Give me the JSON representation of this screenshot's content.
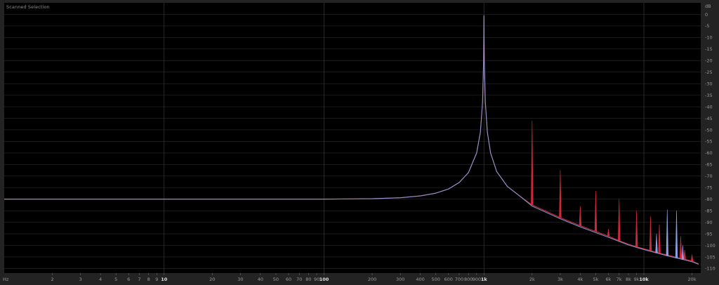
{
  "panel": {
    "title": "Scanned Selection"
  },
  "colors": {
    "background": "#000000",
    "frame": "#232323",
    "grid": "#2a2a2a",
    "channel_left": "#d0283a",
    "channel_right": "#8aa0e0"
  },
  "chart_data": {
    "type": "line",
    "title": "Scanned Selection",
    "x_scale": "log",
    "x_unit_label": "Hz",
    "y_unit_label": "dB",
    "xlim": [
      1,
      22000
    ],
    "ylim": [
      -112,
      5
    ],
    "grid": true,
    "x_ticks": [
      {
        "value": 2,
        "label": "2"
      },
      {
        "value": 3,
        "label": "3"
      },
      {
        "value": 4,
        "label": "4"
      },
      {
        "value": 5,
        "label": "5"
      },
      {
        "value": 6,
        "label": "6"
      },
      {
        "value": 7,
        "label": "7"
      },
      {
        "value": 8,
        "label": "8"
      },
      {
        "value": 9,
        "label": "9"
      },
      {
        "value": 10,
        "label": "10",
        "major": true
      },
      {
        "value": 20,
        "label": "20"
      },
      {
        "value": 30,
        "label": "30"
      },
      {
        "value": 40,
        "label": "40"
      },
      {
        "value": 50,
        "label": "50"
      },
      {
        "value": 60,
        "label": "60"
      },
      {
        "value": 70,
        "label": "70"
      },
      {
        "value": 80,
        "label": "80"
      },
      {
        "value": 90,
        "label": "90"
      },
      {
        "value": 100,
        "label": "100",
        "major": true
      },
      {
        "value": 200,
        "label": "200"
      },
      {
        "value": 300,
        "label": "300"
      },
      {
        "value": 400,
        "label": "400"
      },
      {
        "value": 500,
        "label": "500"
      },
      {
        "value": 600,
        "label": "600"
      },
      {
        "value": 700,
        "label": "700"
      },
      {
        "value": 800,
        "label": "800"
      },
      {
        "value": 900,
        "label": "900"
      },
      {
        "value": 1000,
        "label": "1k",
        "major": true
      },
      {
        "value": 2000,
        "label": "2k"
      },
      {
        "value": 3000,
        "label": "3k"
      },
      {
        "value": 4000,
        "label": "4k"
      },
      {
        "value": 5000,
        "label": "5k"
      },
      {
        "value": 6000,
        "label": "6k"
      },
      {
        "value": 7000,
        "label": "7k"
      },
      {
        "value": 8000,
        "label": "8k"
      },
      {
        "value": 9000,
        "label": "9k"
      },
      {
        "value": 10000,
        "label": "10k",
        "major": true
      },
      {
        "value": 20000,
        "label": "20k"
      }
    ],
    "y_ticks": [
      0,
      -5,
      -10,
      -15,
      -20,
      -25,
      -30,
      -35,
      -40,
      -45,
      -50,
      -55,
      -60,
      -65,
      -70,
      -75,
      -80,
      -85,
      -90,
      -95,
      -100,
      -105,
      -110
    ],
    "series": [
      {
        "channel": "left",
        "points": [
          [
            1,
            -80
          ],
          [
            10,
            -80
          ],
          [
            100,
            -80
          ],
          [
            200,
            -79.8
          ],
          [
            300,
            -79.4
          ],
          [
            400,
            -78.6
          ],
          [
            500,
            -77.4
          ],
          [
            600,
            -75.6
          ],
          [
            700,
            -72.8
          ],
          [
            800,
            -68.5
          ],
          [
            900,
            -60
          ],
          [
            950,
            -51
          ],
          [
            980,
            -38
          ],
          [
            995,
            -20
          ],
          [
            1000,
            -1
          ],
          [
            1005,
            -20
          ],
          [
            1020,
            -38
          ],
          [
            1050,
            -51
          ],
          [
            1100,
            -60
          ],
          [
            1200,
            -68
          ],
          [
            1400,
            -74.5
          ],
          [
            1700,
            -79
          ],
          [
            2000,
            -82.5
          ],
          [
            3000,
            -88
          ],
          [
            4000,
            -91.5
          ],
          [
            5000,
            -94
          ],
          [
            6000,
            -96
          ],
          [
            7000,
            -98
          ],
          [
            8000,
            -99.5
          ],
          [
            9000,
            -100.6
          ],
          [
            10000,
            -101.5
          ],
          [
            12000,
            -103
          ],
          [
            14000,
            -104.2
          ],
          [
            16000,
            -105.2
          ],
          [
            18000,
            -106
          ],
          [
            20000,
            -106.8
          ],
          [
            22000,
            -108
          ]
        ],
        "harmonics": [
          [
            2000,
            -46
          ],
          [
            3000,
            -67.5
          ],
          [
            4000,
            -83
          ],
          [
            5000,
            -76.5
          ],
          [
            6000,
            -93
          ],
          [
            7000,
            -80
          ],
          [
            9000,
            -85
          ],
          [
            11000,
            -87.5
          ],
          [
            12500,
            -91
          ],
          [
            17000,
            -96
          ],
          [
            18000,
            -102
          ],
          [
            20000,
            -104
          ]
        ]
      },
      {
        "channel": "right",
        "points": [
          [
            1,
            -80
          ],
          [
            10,
            -80
          ],
          [
            100,
            -80
          ],
          [
            200,
            -79.8
          ],
          [
            300,
            -79.4
          ],
          [
            400,
            -78.6
          ],
          [
            500,
            -77.4
          ],
          [
            600,
            -75.6
          ],
          [
            700,
            -72.8
          ],
          [
            800,
            -68.5
          ],
          [
            900,
            -60
          ],
          [
            950,
            -51
          ],
          [
            980,
            -38
          ],
          [
            995,
            -20
          ],
          [
            1000,
            -0.5
          ],
          [
            1005,
            -20
          ],
          [
            1020,
            -38
          ],
          [
            1050,
            -51
          ],
          [
            1100,
            -60
          ],
          [
            1200,
            -68
          ],
          [
            1400,
            -74.5
          ],
          [
            1700,
            -79
          ],
          [
            2000,
            -83
          ],
          [
            3000,
            -88.5
          ],
          [
            4000,
            -92
          ],
          [
            5000,
            -94.5
          ],
          [
            6000,
            -96.5
          ],
          [
            7000,
            -98.3
          ],
          [
            8000,
            -99.8
          ],
          [
            9000,
            -100.9
          ],
          [
            10000,
            -101.8
          ],
          [
            12000,
            -103.3
          ],
          [
            14000,
            -104.5
          ],
          [
            16000,
            -105.5
          ],
          [
            18000,
            -106.3
          ],
          [
            20000,
            -107.1
          ],
          [
            22000,
            -108.2
          ]
        ],
        "harmonics": [
          [
            12000,
            -95
          ],
          [
            14000,
            -84.5
          ],
          [
            16000,
            -85
          ],
          [
            17500,
            -100
          ]
        ]
      }
    ]
  }
}
